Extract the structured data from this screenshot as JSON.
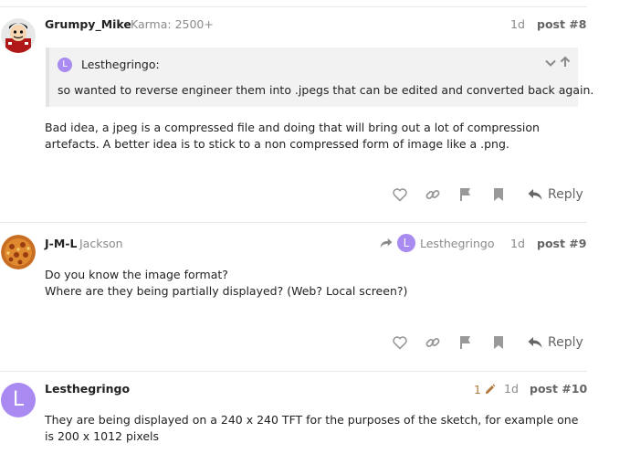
{
  "posts": [
    {
      "username": "Grumpy_Mike",
      "user_title": "Karma: 2500+",
      "age": "1d",
      "post_number": "post #8",
      "quote_author": "Lesthegringo:",
      "quote_author_initial": "L",
      "quote_text": "so wanted to reverse engineer them into .jpegs that can be edited and converted back again.",
      "body": [
        "Bad idea, a jpeg is a compressed file and doing that will bring out a lot of compression artefacts. A better idea is to stick to a non compressed form of image like a .png."
      ],
      "reply_label": "Reply"
    },
    {
      "username": "J-M-L",
      "user_title": "Jackson",
      "reply_to_user": "Lesthegringo",
      "reply_to_initial": "L",
      "age": "1d",
      "post_number": "post #9",
      "body": [
        "Do you know the image format?",
        "Where are they being partially displayed? (Web? Local screen?)"
      ],
      "reply_label": "Reply"
    },
    {
      "username": "Lesthegringo",
      "avatar_initial": "L",
      "edit_count": "1",
      "age": "1d",
      "post_number": "post #10",
      "body": [
        "They are being displayed on a 240 x 240 TFT for the purposes of the sketch, for example one is 200 x 1012 pixels"
      ]
    }
  ],
  "icons": [
    "like-icon",
    "link-icon",
    "flag-icon",
    "bookmark-icon",
    "reply-arrow-icon",
    "edit-pencil-icon",
    "chevron-down-icon",
    "arrow-up-icon"
  ],
  "colors": {
    "avatar_purple": "#a88af0",
    "muted_text": "#8a8a8a",
    "action_icon": "#999999",
    "edit_orange": "#b27a3d"
  }
}
